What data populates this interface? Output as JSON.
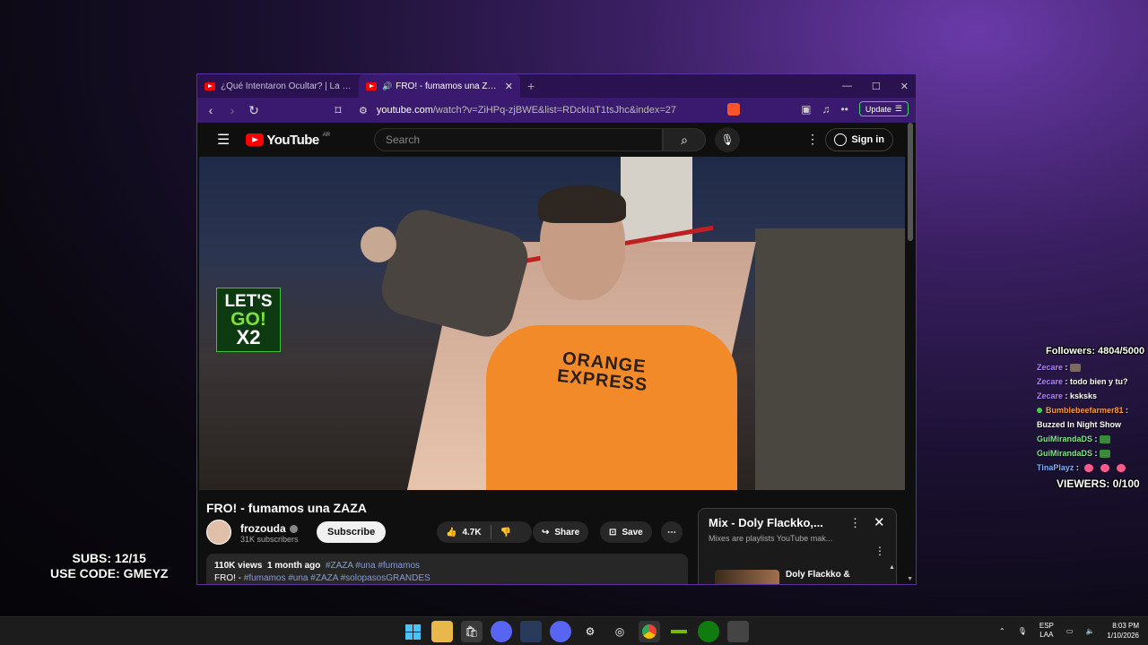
{
  "browser": {
    "tabs": [
      {
        "title": "¿Qué Intentaron Ocultar? | La Verdad",
        "active": false
      },
      {
        "title": "FRO! - fumamos una ZAZA -",
        "active": true
      }
    ],
    "url_domain": "youtube.com",
    "url_path": "/watch?v=ZiHPq-zjBWE&list=RDckIaT1tsJhc&index=27",
    "update_label": "Update"
  },
  "youtube": {
    "logo_text": "YouTube",
    "country": "AR",
    "search_placeholder": "Search",
    "signin_label": "Sign in",
    "overlay_sticker": {
      "line1": "LET'S",
      "line2": "GO!",
      "line3": "X2"
    },
    "shirt_text": "ORANGE\nEXPRESS",
    "video_title": "FRO! - fumamos una ZAZA",
    "channel_name": "frozouda",
    "subscribers": "31K subscribers",
    "subscribe_label": "Subscribe",
    "likes": "4.7K",
    "share_label": "Share",
    "save_label": "Save",
    "views": "110K views",
    "uploaded": "1 month ago",
    "hashtags": "#ZAZA #una #fumamos",
    "desc_prefix": "FRO! - ",
    "desc_tags": "#fumamos #una #ZAZA #solopasosGRANDES",
    "mix_title": "Mix - Doly Flackko,...",
    "mix_sub": "Mixes are playlists YouTube mak...",
    "mix_item_title": "Doly Flackko &"
  },
  "overlay": {
    "followers": "Followers: 4804/5000",
    "viewers": "VIEWERS: 0/100",
    "subs_line1": "SUBS: 12/15",
    "subs_line2": "USE CODE: GMEYZ",
    "chat": [
      {
        "user": "Zecare",
        "text": "",
        "emote": true,
        "color": "purple"
      },
      {
        "user": "Zecare",
        "text": "todo bien y tu?",
        "color": "purple"
      },
      {
        "user": "Zecare",
        "text": "ksksks",
        "color": "purple"
      },
      {
        "user": "Bumblebeefarmer81",
        "text": "Buzzed In  Night Show",
        "color": "orange"
      },
      {
        "user": "GuiMirandaDS",
        "text": "",
        "emote": true,
        "color": "green"
      },
      {
        "user": "GuiMirandaDS",
        "text": "",
        "emote": true,
        "color": "green"
      },
      {
        "user": "TinaPlayz",
        "text": "",
        "hearts": true,
        "color": "blue"
      }
    ]
  },
  "taskbar": {
    "lang1": "ESP",
    "lang2": "LAA",
    "time": "8:03 PM",
    "date": "1/10/2026"
  }
}
